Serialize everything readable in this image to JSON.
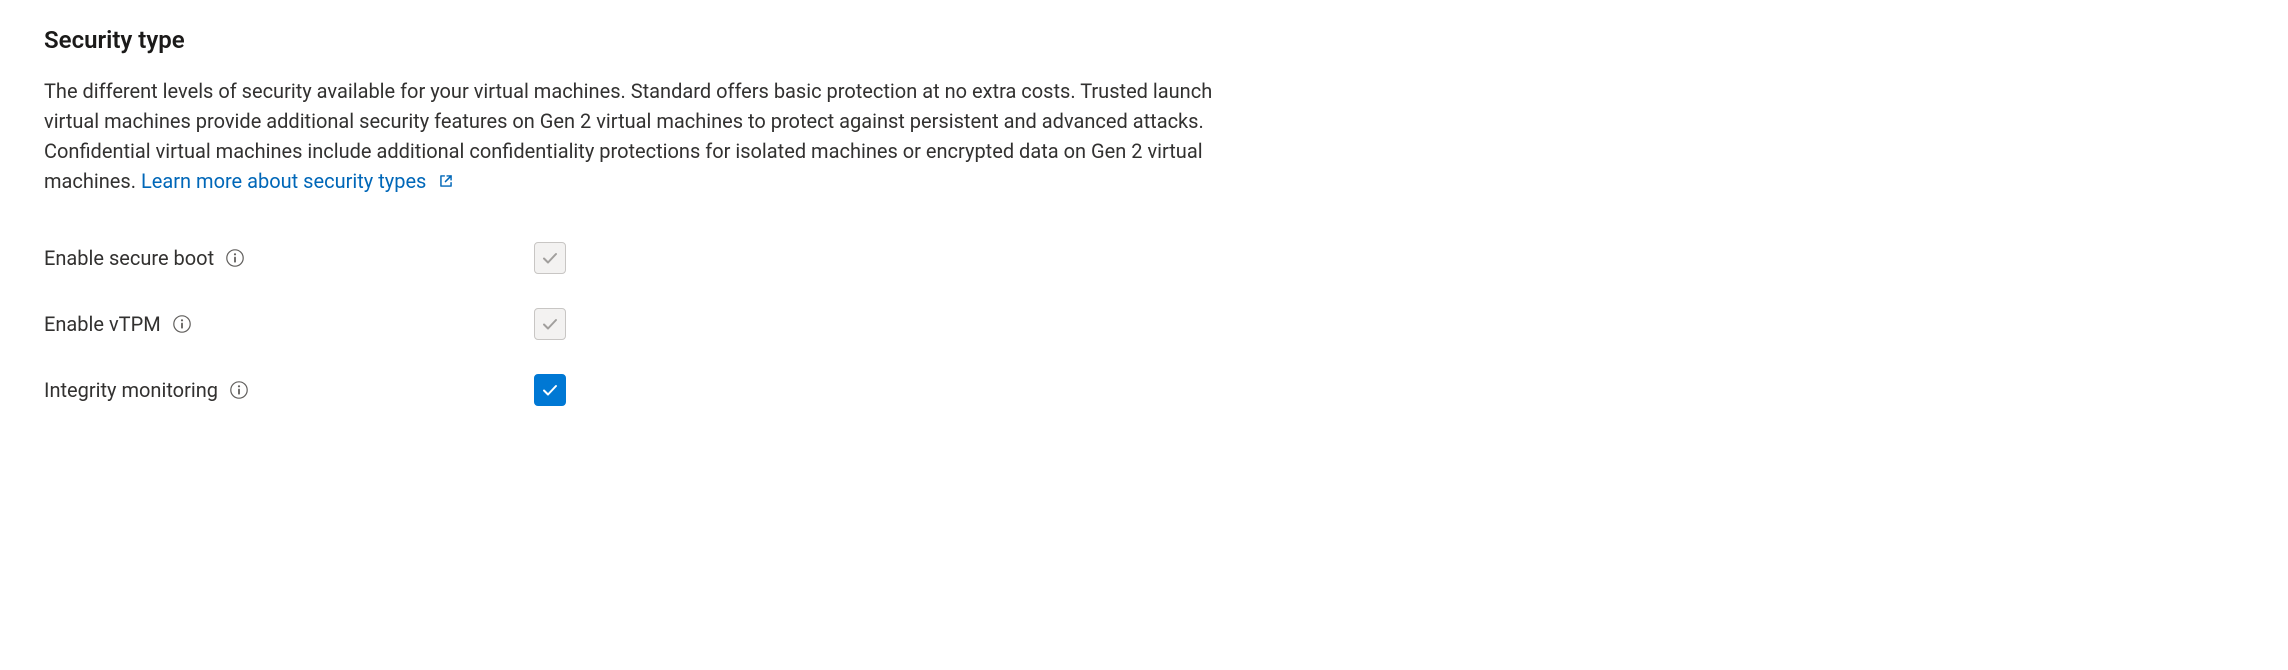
{
  "section": {
    "heading": "Security type",
    "description": "The different levels of security available for your virtual machines. Standard offers basic protection at no extra costs. Trusted launch virtual machines provide additional security features on Gen 2 virtual machines to protect against persistent and advanced attacks. Confidential virtual machines include additional confidentiality protections for isolated machines or encrypted data on Gen 2 virtual machines. ",
    "link_text": "Learn more about security types"
  },
  "fields": {
    "secure_boot": {
      "label": "Enable secure boot",
      "checked": true,
      "disabled": true
    },
    "vtpm": {
      "label": "Enable vTPM",
      "checked": true,
      "disabled": true
    },
    "integrity": {
      "label": "Integrity monitoring",
      "checked": true,
      "disabled": false
    }
  }
}
